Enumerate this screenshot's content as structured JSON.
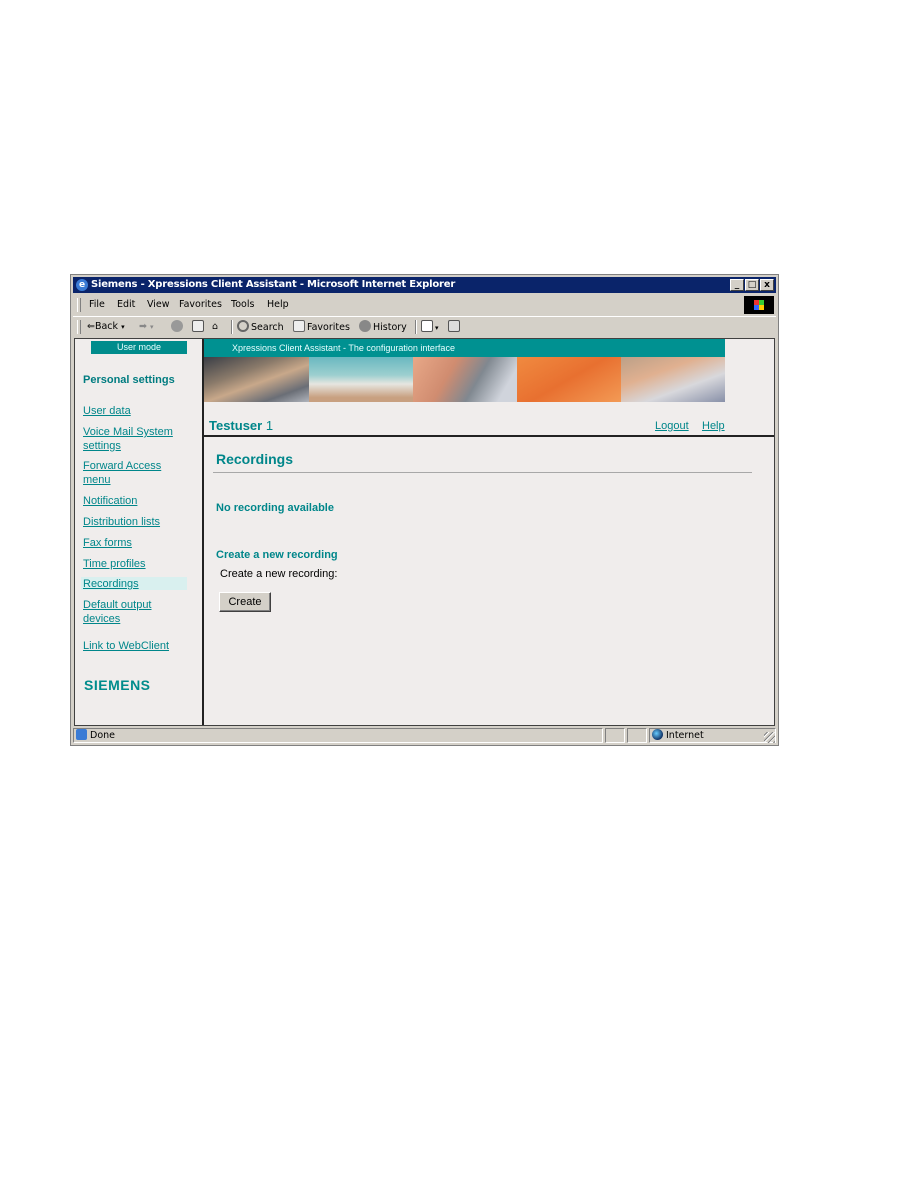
{
  "window": {
    "title": "Siemens - Xpressions Client Assistant - Microsoft Internet Explorer",
    "controls": {
      "minimize": "_",
      "maximize": "□",
      "close": "x"
    }
  },
  "menubar": {
    "items": [
      {
        "label": "File",
        "accel": "F"
      },
      {
        "label": "Edit",
        "accel": "E"
      },
      {
        "label": "View",
        "accel": "V"
      },
      {
        "label": "Favorites",
        "accel": "a"
      },
      {
        "label": "Tools",
        "accel": "T"
      },
      {
        "label": "Help",
        "accel": "H"
      }
    ]
  },
  "toolbar": {
    "back_label": "Back",
    "search_label": "Search",
    "favorites_label": "Favorites",
    "history_label": "History"
  },
  "sidebar": {
    "mode_label": "User mode",
    "section_title": "Personal settings",
    "items": [
      {
        "label": "User data"
      },
      {
        "label": "Voice Mail System",
        "label2": "settings"
      },
      {
        "label": "Forward Access",
        "label2": "menu"
      },
      {
        "label": "Notification"
      },
      {
        "label": "Distribution lists"
      },
      {
        "label": "Fax forms"
      },
      {
        "label": "Time profiles"
      },
      {
        "label": "Recordings",
        "active": true
      },
      {
        "label": "Default output",
        "label2": "devices"
      },
      {
        "label": "Link to WebClient"
      }
    ],
    "logo_text": "SIEMENS"
  },
  "banner": {
    "caption": "Xpressions Client Assistant - The configuration interface"
  },
  "header": {
    "user_name": "Testuser",
    "user_suffix": "1",
    "logout_label": "Logout",
    "help_label": "Help"
  },
  "main": {
    "page_title": "Recordings",
    "empty_message": "No recording available",
    "create_heading": "Create a new recording",
    "create_label": "Create a new recording:",
    "create_button": "Create"
  },
  "statusbar": {
    "status_text": "Done",
    "zone_text": "Internet"
  },
  "colors": {
    "accent": "#00868a",
    "titlebar": "#0a246a",
    "content_bg": "#f0edec"
  }
}
